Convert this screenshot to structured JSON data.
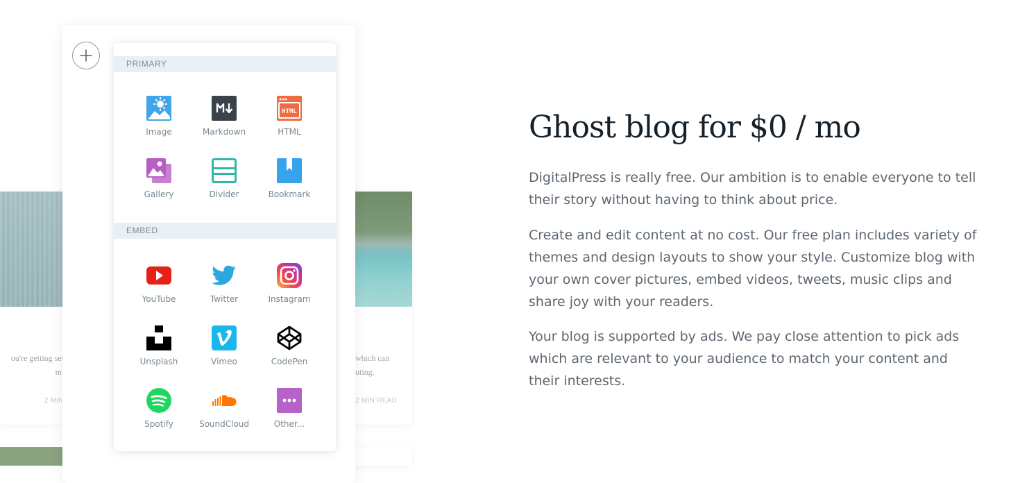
{
  "editor": {
    "sections": [
      {
        "title": "PRIMARY",
        "items": [
          {
            "label": "Image",
            "icon": "image-icon"
          },
          {
            "label": "Markdown",
            "icon": "markdown-icon"
          },
          {
            "label": "HTML",
            "icon": "html-icon"
          },
          {
            "label": "Gallery",
            "icon": "gallery-icon"
          },
          {
            "label": "Divider",
            "icon": "divider-icon"
          },
          {
            "label": "Bookmark",
            "icon": "bookmark-icon"
          }
        ]
      },
      {
        "title": "EMBED",
        "items": [
          {
            "label": "YouTube",
            "icon": "youtube-icon"
          },
          {
            "label": "Twitter",
            "icon": "twitter-icon"
          },
          {
            "label": "Instagram",
            "icon": "instagram-icon"
          },
          {
            "label": "Unsplash",
            "icon": "unsplash-icon"
          },
          {
            "label": "Vimeo",
            "icon": "vimeo-icon"
          },
          {
            "label": "CodePen",
            "icon": "codepen-icon"
          },
          {
            "label": "Spotify",
            "icon": "spotify-icon"
          },
          {
            "label": "SoundCloud",
            "icon": "soundcloud-icon"
          },
          {
            "label": "Other...",
            "icon": "more-icon"
          }
        ]
      }
    ]
  },
  "background_cards": {
    "left": {
      "excerpt_line1": "ou're getting set",
      "excerpt_line2": "m.",
      "meta": "2 MIN"
    },
    "right": {
      "excerpt_line1": "which can",
      "excerpt_line2": "uting.",
      "meta": "2 MIN READ"
    }
  },
  "content": {
    "headline": "Ghost blog for $0 / mo",
    "paragraphs": [
      "DigitalPress is really free. Our ambition is to enable everyone to tell their story without having to think about price.",
      "Create and edit content at no cost. Our free plan includes variety of themes and design layouts to show your style. Customize blog with your own cover pictures, embed videos, tweets, music clips and share joy with your readers.",
      "Your blog is supported by ads. We pay close attention to pick ads which are relevant to your audience to match your content and their interests."
    ]
  },
  "colors": {
    "headline": "#15212a",
    "body_text": "#5d6770",
    "section_header_bg": "#e8eff5",
    "item_label": "#788790"
  }
}
